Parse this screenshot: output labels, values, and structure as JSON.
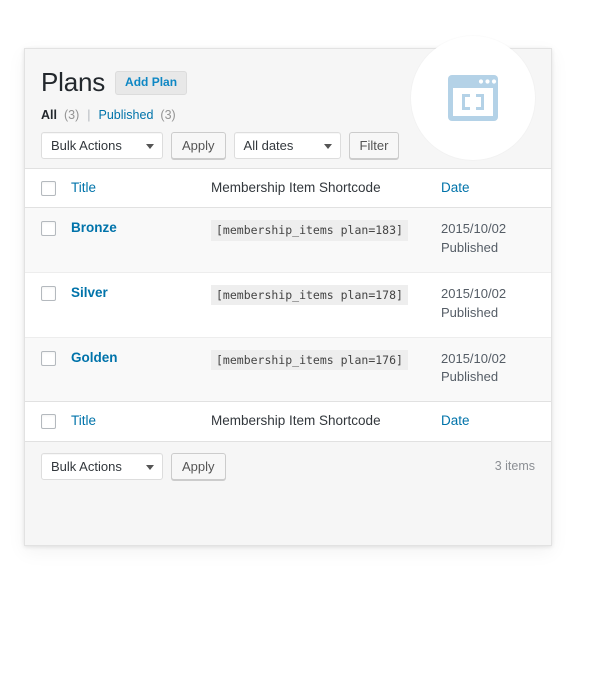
{
  "page": {
    "title": "Plans",
    "add_button_label": "Add Plan"
  },
  "filters": {
    "all_label": "All",
    "all_count": "(3)",
    "separator": "|",
    "published_label": "Published",
    "published_count": "(3)"
  },
  "toolbar_top": {
    "bulk_actions_label": "Bulk Actions",
    "apply_label": "Apply",
    "dates_label": "All dates",
    "filter_label": "Filter"
  },
  "toolbar_bottom": {
    "bulk_actions_label": "Bulk Actions",
    "apply_label": "Apply",
    "items_count": "3 items"
  },
  "table": {
    "columns": {
      "title": "Title",
      "shortcode": "Membership Item Shortcode",
      "date": "Date"
    },
    "rows": [
      {
        "title": "Bronze",
        "shortcode": "[membership_items plan=183]",
        "date": "2015/10/02",
        "status": "Published"
      },
      {
        "title": "Silver",
        "shortcode": "[membership_items plan=178]",
        "date": "2015/10/02",
        "status": "Published"
      },
      {
        "title": "Golden",
        "shortcode": "[membership_items plan=176]",
        "date": "2015/10/02",
        "status": "Published"
      }
    ]
  },
  "badge": {
    "icon": "shortcode-window-icon",
    "icon_color": "#b4d2e7",
    "bracket_text": "[ ]"
  },
  "colors": {
    "link": "#0073aa",
    "accent": "#0e87c4",
    "badge_icon": "#b4d2e7",
    "row_alt": "#f9f9f9",
    "panel_bg": "#f6f6f6"
  }
}
